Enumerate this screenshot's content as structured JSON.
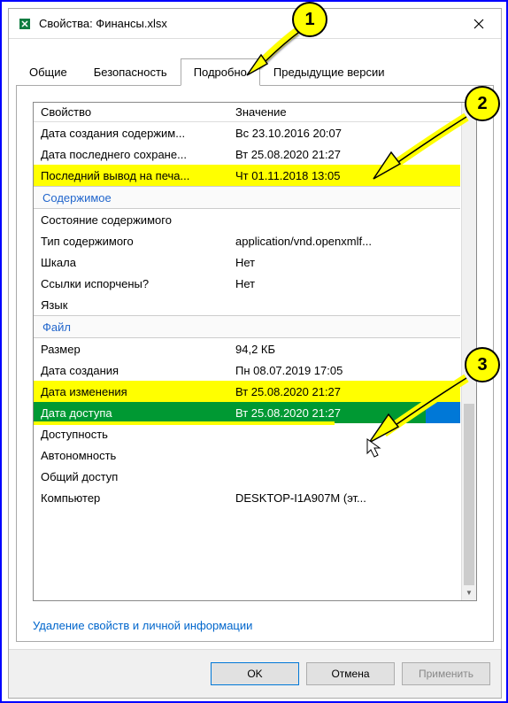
{
  "window": {
    "title": "Свойства: Финансы.xlsx"
  },
  "tabs": {
    "general": "Общие",
    "security": "Безопасность",
    "details": "Подробно",
    "previous": "Предыдущие версии"
  },
  "headers": {
    "property": "Свойство",
    "value": "Значение"
  },
  "rows": {
    "contentCreated": {
      "label": "Дата создания содержим...",
      "value": "Вс 23.10.2016 20:07"
    },
    "lastSaved": {
      "label": "Дата последнего сохране...",
      "value": "Вт 25.08.2020 21:27"
    },
    "lastPrinted": {
      "label": "Последний вывод на печа...",
      "value": "Чт 01.11.2018 13:05"
    },
    "sectionContent": {
      "label": "Содержимое"
    },
    "contentState": {
      "label": "Состояние содержимого",
      "value": ""
    },
    "contentType": {
      "label": "Тип содержимого",
      "value": "application/vnd.openxmlf..."
    },
    "scale": {
      "label": "Шкала",
      "value": "Нет"
    },
    "linksBroken": {
      "label": "Ссылки испорчены?",
      "value": "Нет"
    },
    "language": {
      "label": "Язык",
      "value": ""
    },
    "sectionFile": {
      "label": "Файл"
    },
    "size": {
      "label": "Размер",
      "value": "94,2 КБ"
    },
    "dateCreated": {
      "label": "Дата создания",
      "value": "Пн 08.07.2019 17:05"
    },
    "dateModified": {
      "label": "Дата изменения",
      "value": "Вт 25.08.2020 21:27"
    },
    "dateAccessed": {
      "label": "Дата доступа",
      "value": "Вт 25.08.2020 21:27"
    },
    "availability": {
      "label": "Доступность",
      "value": ""
    },
    "offline": {
      "label": "Автономность",
      "value": ""
    },
    "shared": {
      "label": "Общий доступ",
      "value": ""
    },
    "computer": {
      "label": "Компьютер",
      "value": "DESKTOP-I1A907M (эт..."
    }
  },
  "link": {
    "removeProps": "Удаление свойств и личной информации"
  },
  "buttons": {
    "ok": "OK",
    "cancel": "Отмена",
    "apply": "Применить"
  },
  "annotations": {
    "n1": "1",
    "n2": "2",
    "n3": "3"
  }
}
